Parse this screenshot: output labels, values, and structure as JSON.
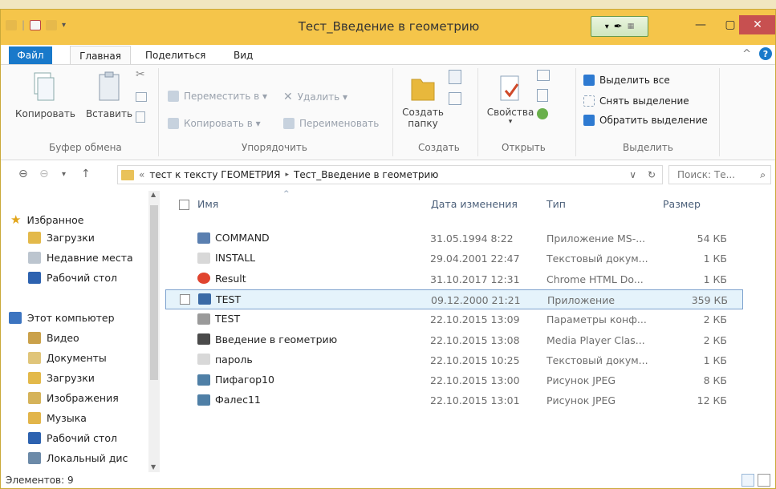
{
  "window": {
    "title": "Тест_Введение в геометрию",
    "signature_glyph": "✒"
  },
  "ribbon_tabs": [
    "Файл",
    "Главная",
    "Поделиться",
    "Вид"
  ],
  "ribbon": {
    "clipboard": {
      "copy": "Копировать",
      "paste": "Вставить",
      "label": "Буфер обмена"
    },
    "organize": {
      "move": "Переместить в ▾",
      "copy_to": "Копировать в ▾",
      "delete": "Удалить ▾",
      "rename": "Переименовать",
      "label": "Упорядочить"
    },
    "create": {
      "new_folder_line1": "Создать",
      "new_folder_line2": "папку",
      "label": "Создать"
    },
    "open": {
      "properties": "Свойства",
      "label": "Открыть"
    },
    "select": {
      "select_all": "Выделить все",
      "select_none": "Снять выделение",
      "invert": "Обратить выделение",
      "label": "Выделить"
    }
  },
  "address": {
    "prefix": "«",
    "crumb1": "тест к тексту ГЕОМЕТРИЯ",
    "sep": "▸",
    "crumb2": "Тест_Введение в геометрию",
    "dropdown": "∨",
    "refresh": "↻",
    "search_placeholder": "Поиск: Те..."
  },
  "nav": {
    "favorites": "Избранное",
    "downloads": "Загрузки",
    "recent": "Недавние места",
    "desktop": "Рабочий стол",
    "computer": "Этот компьютер",
    "video": "Видео",
    "documents": "Документы",
    "downloads2": "Загрузки",
    "images": "Изображения",
    "music": "Музыка",
    "desktop2": "Рабочий стол",
    "localdisk": "Локальный дис"
  },
  "columns": {
    "name": "Имя",
    "date": "Дата изменения",
    "type": "Тип",
    "size": "Размер"
  },
  "files": [
    {
      "name": "COMMAND",
      "date": "31.05.1994 8:22",
      "type": "Приложение MS-...",
      "size": "54 КБ",
      "icon": "app-icon",
      "color": "#5a7fb0"
    },
    {
      "name": "INSTALL",
      "date": "29.04.2001 22:47",
      "type": "Текстовый докум...",
      "size": "1 КБ",
      "icon": "text-file-icon",
      "color": "#d8d8d8"
    },
    {
      "name": "Result",
      "date": "31.10.2017 12:31",
      "type": "Chrome HTML Do...",
      "size": "1 КБ",
      "icon": "chrome-icon",
      "color": "#e0442f"
    },
    {
      "name": "TEST",
      "date": "09.12.2000 21:21",
      "type": "Приложение",
      "size": "359 КБ",
      "icon": "exe-icon",
      "color": "#3a6aa6"
    },
    {
      "name": "TEST",
      "date": "22.10.2015 13:09",
      "type": "Параметры конф...",
      "size": "2 КБ",
      "icon": "config-icon",
      "color": "#9a9a9a"
    },
    {
      "name": "Введение в геометрию",
      "date": "22.10.2015 13:08",
      "type": "Media Player Clas...",
      "size": "2 КБ",
      "icon": "media-icon",
      "color": "#4a4a4a"
    },
    {
      "name": "пароль",
      "date": "22.10.2015 10:25",
      "type": "Текстовый докум...",
      "size": "1 КБ",
      "icon": "text-file-icon",
      "color": "#d8d8d8"
    },
    {
      "name": "Пифагор10",
      "date": "22.10.2015 13:00",
      "type": "Рисунок JPEG",
      "size": "8 КБ",
      "icon": "image-icon",
      "color": "#4f7fa6"
    },
    {
      "name": "Фалес11",
      "date": "22.10.2015 13:01",
      "type": "Рисунок JPEG",
      "size": "12 КБ",
      "icon": "image-icon",
      "color": "#4f7fa6"
    }
  ],
  "status": {
    "count": "Элементов: 9"
  }
}
